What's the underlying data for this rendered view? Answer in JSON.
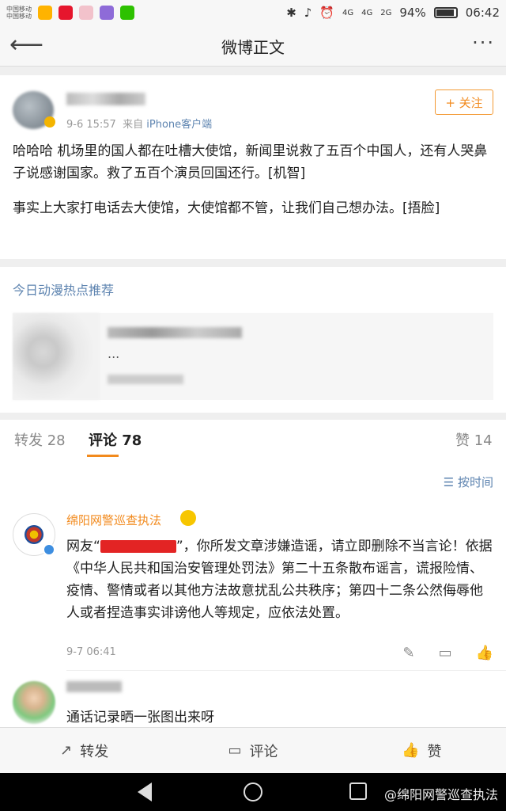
{
  "status": {
    "carrier1": "中国移动",
    "carrier2": "中国移动",
    "network1": "4G",
    "network2": "4G",
    "network3": "2G",
    "battery": "94%",
    "time": "06:42"
  },
  "header": {
    "title": "微博正文"
  },
  "post": {
    "time": "9-6 15:57",
    "source_prefix": "来自",
    "source": "iPhone客户端",
    "follow_label": "+ 关注",
    "paragraph1": "哈哈哈 机场里的国人都在吐槽大使馆，新闻里说救了五百个中国人，还有人哭鼻子说感谢国家。救了五百个演员回国还行。[机智]",
    "paragraph2": "事实上大家打电话去大使馆，大使馆都不管，让我们自己想办法。[捂脸]"
  },
  "recommend": {
    "title": "今日动漫热点推荐",
    "ellipsis": "..."
  },
  "tabs": {
    "repost": "转发 28",
    "comment": "评论 78",
    "like": "赞 14"
  },
  "comments": {
    "sort_label": "按时间",
    "c1": {
      "name": "绵阳网警巡查执法",
      "text_before": "网友“",
      "text_after": "”，你所发文章涉嫌造谣，请立即删除不当言论！依据《中华人民共和国治安管理处罚法》第二十五条散布谣言，谎报险情、疫情、警情或者以其他方法故意扰乱公共秩序；第四十二条公然侮辱他人或者捏造事实诽谤他人等规定，应依法处置。",
      "time": "9-7 06:41"
    },
    "c2": {
      "text": "通话记录晒一张图出来呀"
    }
  },
  "actionbar": {
    "repost": "转发",
    "comment": "评论",
    "like": "赞"
  },
  "watermark": "@绵阳网警巡查执法"
}
